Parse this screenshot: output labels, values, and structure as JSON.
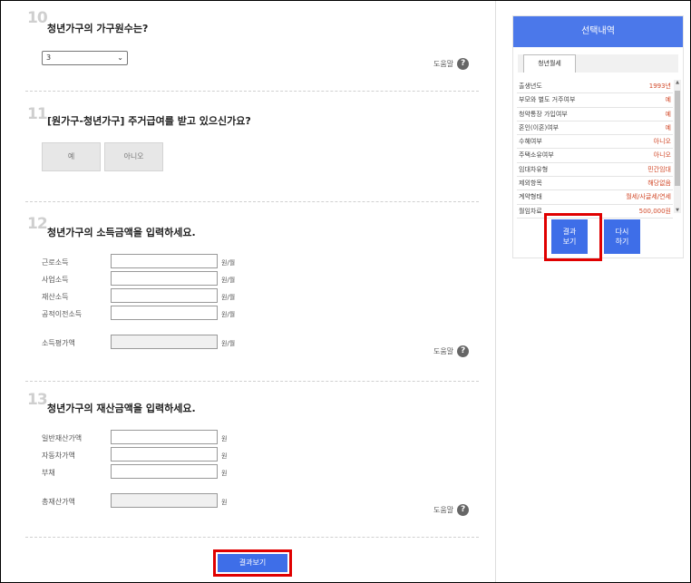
{
  "q10": {
    "number": "10",
    "title": "청년가구의 가구원수는?",
    "select_value": "3",
    "help_label": "도움말"
  },
  "q11": {
    "number": "11",
    "title": "[원가구-청년가구] 주거급여를 받고 있으신가요?",
    "yes_label": "예",
    "no_label": "아니오"
  },
  "q12": {
    "number": "12",
    "title": "청년가구의 소득금액을 입력하세요.",
    "fields": [
      {
        "label": "근로소득",
        "value": "",
        "unit": "원/월"
      },
      {
        "label": "사업소득",
        "value": "",
        "unit": "원/월"
      },
      {
        "label": "재산소득",
        "value": "",
        "unit": "원/월"
      },
      {
        "label": "공적이전소득",
        "value": "",
        "unit": "원/월"
      }
    ],
    "total": {
      "label": "소득평가액",
      "value": "",
      "unit": "원/월"
    },
    "help_label": "도움말"
  },
  "q13": {
    "number": "13",
    "title": "청년가구의 재산금액을 입력하세요.",
    "fields": [
      {
        "label": "일반재산가액",
        "value": "",
        "unit": "원"
      },
      {
        "label": "자동차가액",
        "value": "",
        "unit": "원"
      },
      {
        "label": "부채",
        "value": "",
        "unit": "원"
      }
    ],
    "total": {
      "label": "총재산가액",
      "value": "",
      "unit": "원"
    },
    "help_label": "도움말"
  },
  "bottom_button": "결과보기",
  "panel": {
    "title": "선택내역",
    "tab": "청년월세",
    "rows": [
      {
        "key": "출생년도",
        "value": "1993년"
      },
      {
        "key": "부모와 별도 거주여부",
        "value": "예"
      },
      {
        "key": "청약통장 가입여부",
        "value": "예"
      },
      {
        "key": "혼인(이혼)여부",
        "value": "예"
      },
      {
        "key": "수혜여부",
        "value": "아니오"
      },
      {
        "key": "주택소유여부",
        "value": "아니오"
      },
      {
        "key": "임대차유형",
        "value": "민간임대"
      },
      {
        "key": "제외항목",
        "value": "해당없음"
      },
      {
        "key": "계약형태",
        "value": "월세/사글세/연세"
      },
      {
        "key": "월임차료",
        "value": "500,000원"
      }
    ],
    "result_button": [
      "결과",
      "보기"
    ],
    "reset_button": [
      "다시",
      "하기"
    ]
  },
  "colors": {
    "accent": "#3e6ee8",
    "header": "#4b78ea",
    "value_red": "#d24a2a",
    "highlight": "#e00000"
  }
}
